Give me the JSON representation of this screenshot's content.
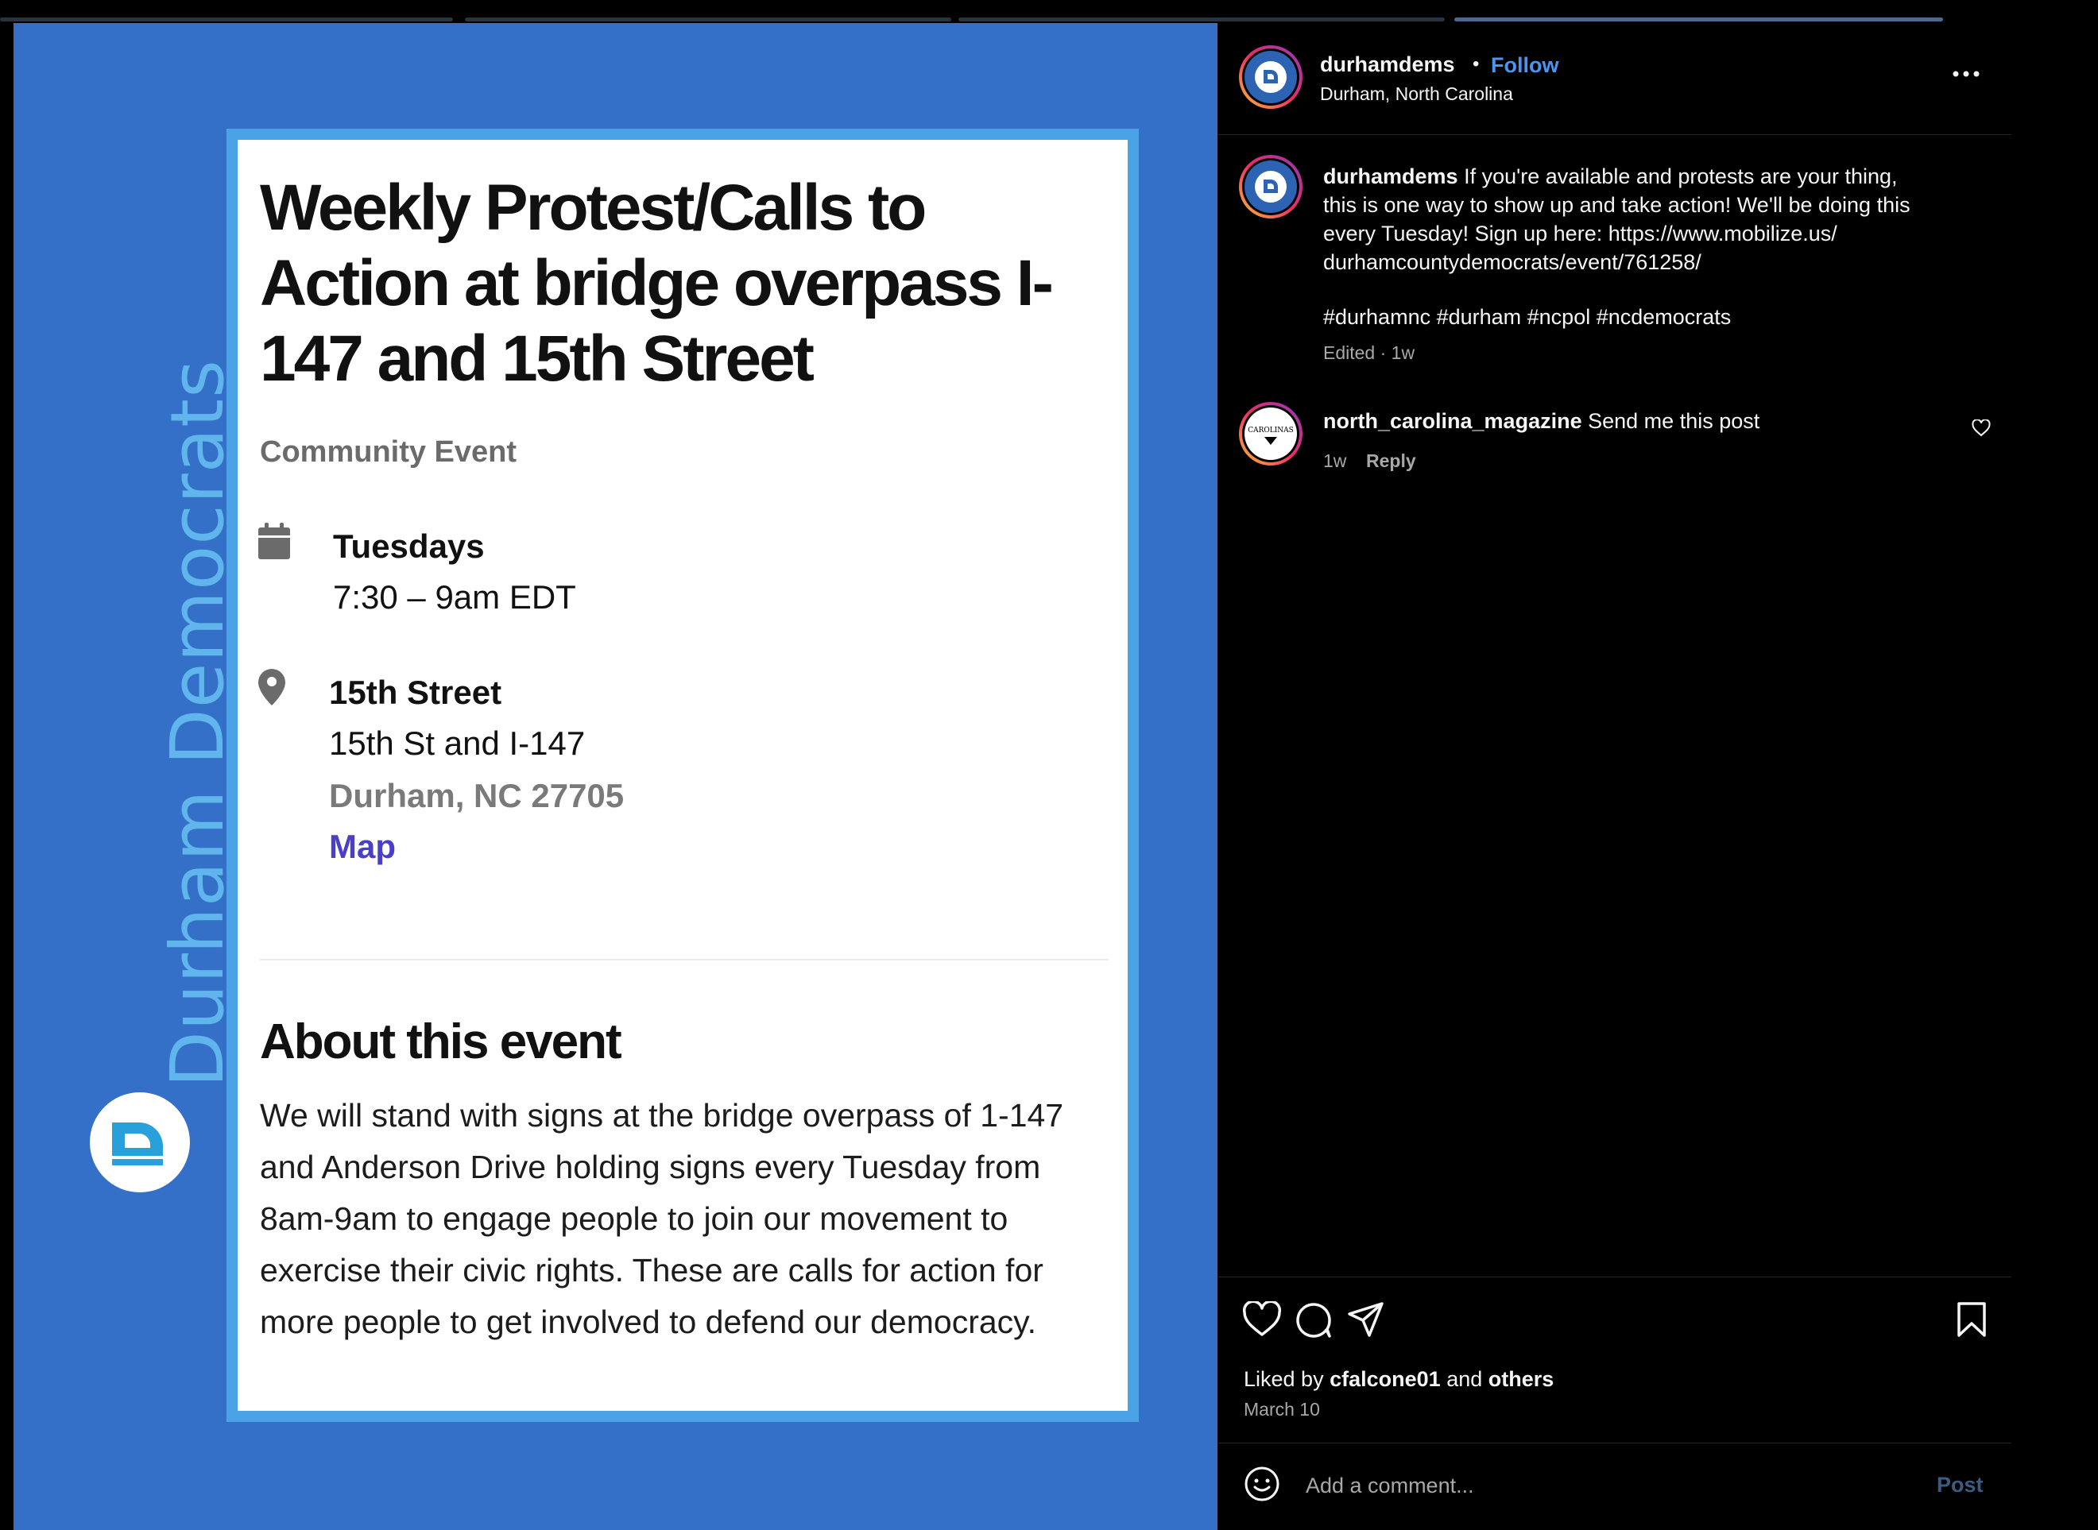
{
  "story_progress": {
    "segments": 4,
    "active_index": 3
  },
  "post_image": {
    "brand_text": "Durham Democrats",
    "logo_letter": "D",
    "event": {
      "title": "Weekly Protest/Calls to Action at bridge overpass I-147 and 15th Street",
      "category": "Community Event",
      "when_day": "Tuesdays",
      "when_time": "7:30 – 9am EDT",
      "where_name": "15th Street",
      "where_street": "15th St and I-147",
      "where_city": "Durham, NC 27705",
      "map_label": "Map",
      "about_title": "About this event",
      "about_body": "We will stand with signs at the bridge overpass of 1-147 and Anderson Drive holding signs every Tuesday from 8am-9am to engage people to join our movement to exercise their civic rights. These are calls for action for more people to get involved to defend our democracy."
    },
    "colors": {
      "background": "#3470c8",
      "card_border": "#4aa3e6",
      "brand_text": "#60b6ec",
      "map_link": "#4a3fc8"
    }
  },
  "sidebar": {
    "header": {
      "username": "durhamdems",
      "separator": "•",
      "follow_label": "Follow",
      "location": "Durham, North Carolina"
    },
    "caption": {
      "username": "durhamdems",
      "line1": "If you're available and protests are your thing,",
      "line2": "this is one way to show up and take action! We'll be doing this",
      "line3": "every Tuesday! Sign up here: https://www.mobilize.us/",
      "line4": "durhamcountydemocrats/event/761258/",
      "hashtags": "#durhamnc #durham #ncpol #ncdemocrats",
      "meta": "Edited · 1w"
    },
    "comment": {
      "username": "north_carolina_magazine",
      "text": "Send me this post",
      "time": "1w",
      "reply_label": "Reply",
      "avatar_text": "CAROLINAS"
    },
    "likes": {
      "prefix": "Liked by",
      "user": "cfalcone01",
      "connector": "and",
      "others": "others"
    },
    "date": "March 10",
    "comment_box": {
      "placeholder": "Add a comment...",
      "post_label": "Post"
    },
    "colors": {
      "follow": "#4a95f2",
      "post_disabled": "#3c5b80",
      "secondary_text": "#a8a8a8"
    },
    "icons": [
      "more-icon",
      "heart-icon",
      "comment-icon",
      "share-icon",
      "bookmark-icon",
      "emoji-icon"
    ]
  }
}
